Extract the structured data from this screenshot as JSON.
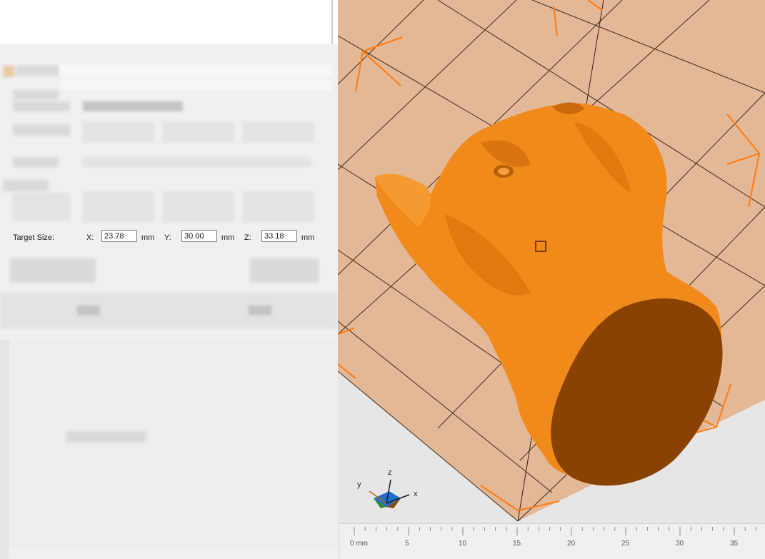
{
  "dialog": {
    "target_size": {
      "label": "Target Size:",
      "x_label": "X:",
      "x_value": "23.78",
      "y_label": "Y:",
      "y_value": "30.00",
      "z_label": "Z:",
      "z_value": "33.18",
      "unit": "mm"
    }
  },
  "viewport": {
    "model_color": "#f08a1a",
    "model_cut_color": "#8a4200",
    "bed_color": "#e3b896",
    "bounds_color": "#ff7a10",
    "axis_gizmo": {
      "x": "x",
      "y": "y",
      "z": "z"
    },
    "ruler": {
      "labels": [
        "0 mm",
        "5",
        "10",
        "15",
        "20",
        "25",
        "30",
        "35"
      ]
    }
  }
}
